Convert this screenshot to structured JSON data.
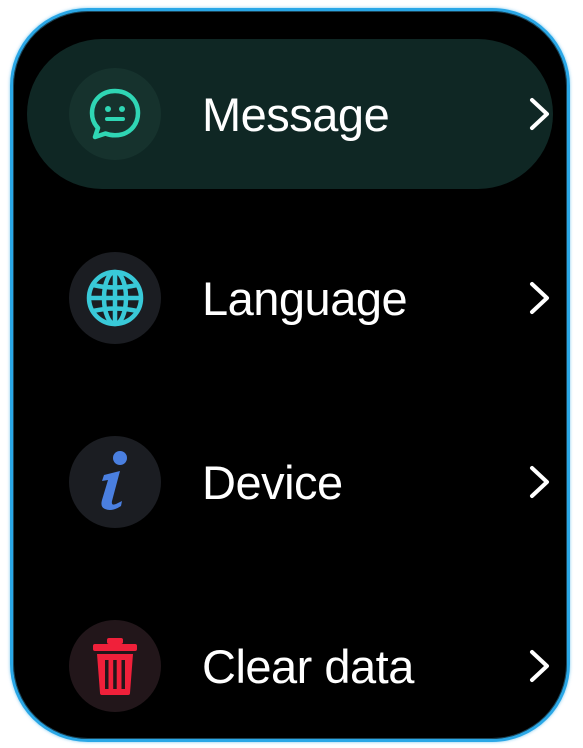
{
  "menu": {
    "items": [
      {
        "label": "Message",
        "icon": "message-icon",
        "icon_color": "#2fd6b4",
        "selected": true
      },
      {
        "label": "Language",
        "icon": "globe-icon",
        "icon_color": "#39c9d8",
        "selected": false
      },
      {
        "label": "Device",
        "icon": "info-icon",
        "icon_color": "#4a7fe0",
        "selected": false
      },
      {
        "label": "Clear data",
        "icon": "trash-icon",
        "icon_color": "#f0203a",
        "selected": false
      }
    ]
  },
  "colors": {
    "frame_border": "#2aa7e6",
    "screen_background": "#000000",
    "selected_row": "#0f2724",
    "text": "#ffffff",
    "chevron": "#ffffff"
  }
}
